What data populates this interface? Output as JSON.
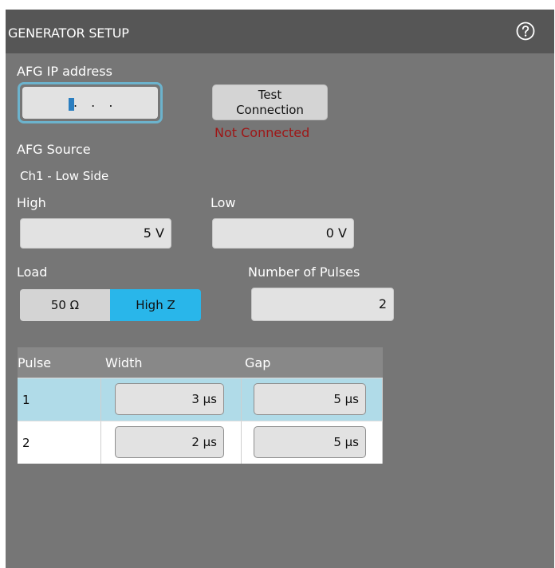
{
  "panel": {
    "title": "GENERATOR SETUP",
    "help_icon": "help-circle-icon"
  },
  "afg_ip": {
    "label": "AFG IP address",
    "value": ". . ."
  },
  "test_connection": {
    "label_line1": "Test",
    "label_line2": "Connection",
    "status": "Not Connected"
  },
  "afg_source": {
    "label": "AFG Source",
    "value": "Ch1 - Low Side"
  },
  "high": {
    "label": "High",
    "value": "5 V"
  },
  "low": {
    "label": "Low",
    "value": "0 V"
  },
  "load": {
    "label": "Load",
    "options": [
      "50 Ω",
      "High Z"
    ],
    "selected": "High Z"
  },
  "pulses": {
    "label": "Number of Pulses",
    "value": "2"
  },
  "table": {
    "headers": [
      "Pulse",
      "Width",
      "Gap"
    ],
    "rows": [
      {
        "pulse": "1",
        "width": "3 µs",
        "gap": "5 µs",
        "selected": true
      },
      {
        "pulse": "2",
        "width": "2 µs",
        "gap": "5 µs",
        "selected": false
      }
    ]
  },
  "colors": {
    "panel_bg": "#767676",
    "titlebar_bg": "#565656",
    "accent": "#29b6ea",
    "selected_row": "#b0dbe8",
    "status_red": "#9e1616"
  }
}
